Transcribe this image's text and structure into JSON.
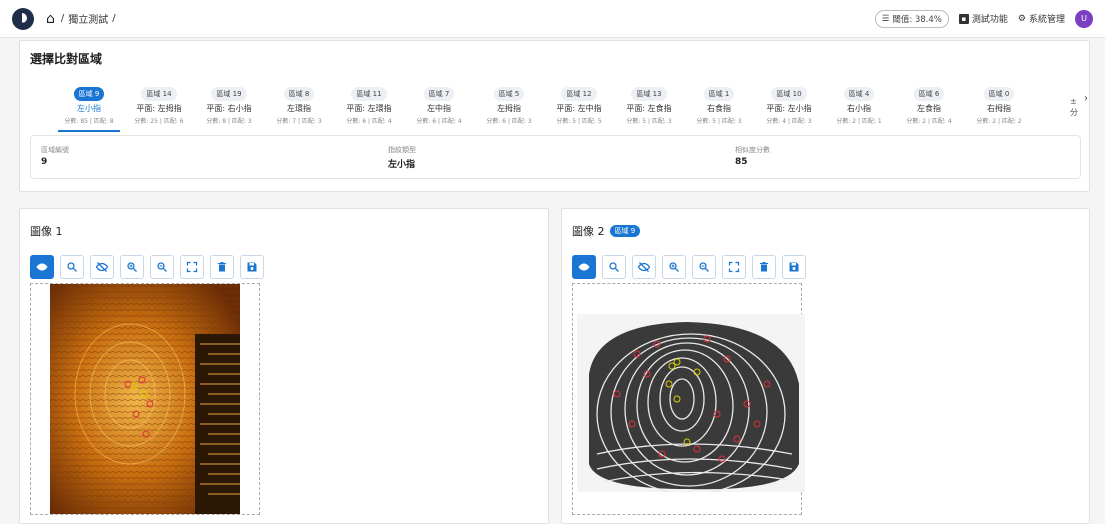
{
  "breadcrumb": {
    "item1": "獨立測試",
    "sep1": "/",
    "sep2": "/"
  },
  "topbar": {
    "threshold_label": "閾值: 38.4%",
    "test_label": "測試功能",
    "admin_label": "系統管理",
    "avatar_letter": "U"
  },
  "region": {
    "title": "選擇比對區域",
    "more_text": "±\n分",
    "tabs": [
      {
        "chip": "區域 9",
        "name": "左小指",
        "score": "分數: 85 | 匹配: 8",
        "active": true
      },
      {
        "chip": "區域 14",
        "name": "平面: 左拇指",
        "score": "分數: 25 | 匹配: 6"
      },
      {
        "chip": "區域 19",
        "name": "平面: 右小指",
        "score": "分數: 8 | 匹配: 3"
      },
      {
        "chip": "區域 8",
        "name": "左環指",
        "score": "分數: 7 | 匹配: 3"
      },
      {
        "chip": "區域 11",
        "name": "平面: 左環指",
        "score": "分數: 6 | 匹配: 4"
      },
      {
        "chip": "區域 7",
        "name": "左中指",
        "score": "分數: 6 | 匹配: 4"
      },
      {
        "chip": "區域 5",
        "name": "左拇指",
        "score": "分數: 6 | 匹配: 3"
      },
      {
        "chip": "區域 12",
        "name": "平面: 左中指",
        "score": "分數: 5 | 匹配: 5"
      },
      {
        "chip": "區域 13",
        "name": "平面: 左食指",
        "score": "分數: 5 | 匹配: 3"
      },
      {
        "chip": "區域 1",
        "name": "右食指",
        "score": "分數: 5 | 匹配: 3"
      },
      {
        "chip": "區域 10",
        "name": "平面: 左小指",
        "score": "分數: 4 | 匹配: 3"
      },
      {
        "chip": "區域 4",
        "name": "右小指",
        "score": "分數: 2 | 匹配: 1"
      },
      {
        "chip": "區域 6",
        "name": "左食指",
        "score": "分數: 2 | 匹配: 4"
      },
      {
        "chip": "區域 0",
        "name": "右拇指",
        "score": "分數: 2 | 匹配: 2"
      }
    ],
    "info": {
      "region_no_label": "區域編號",
      "region_no": "9",
      "finger_label": "指紋類型",
      "finger": "左小指",
      "similarity_label": "相似度分數",
      "similarity": "85"
    }
  },
  "panel1": {
    "title": "圖像 1"
  },
  "panel2": {
    "title": "圖像 2",
    "badge": "區域 9"
  },
  "tools": [
    "eye-icon",
    "zoom-search-icon",
    "eye-off-icon",
    "zoom-in-icon",
    "zoom-out-icon",
    "fullscreen-icon",
    "delete-icon",
    "save-icon"
  ],
  "colors": {
    "accent": "#1976d2",
    "avatar": "#7b3fc4",
    "match_red": "#e0303a",
    "match_yellow": "#d8d000"
  }
}
